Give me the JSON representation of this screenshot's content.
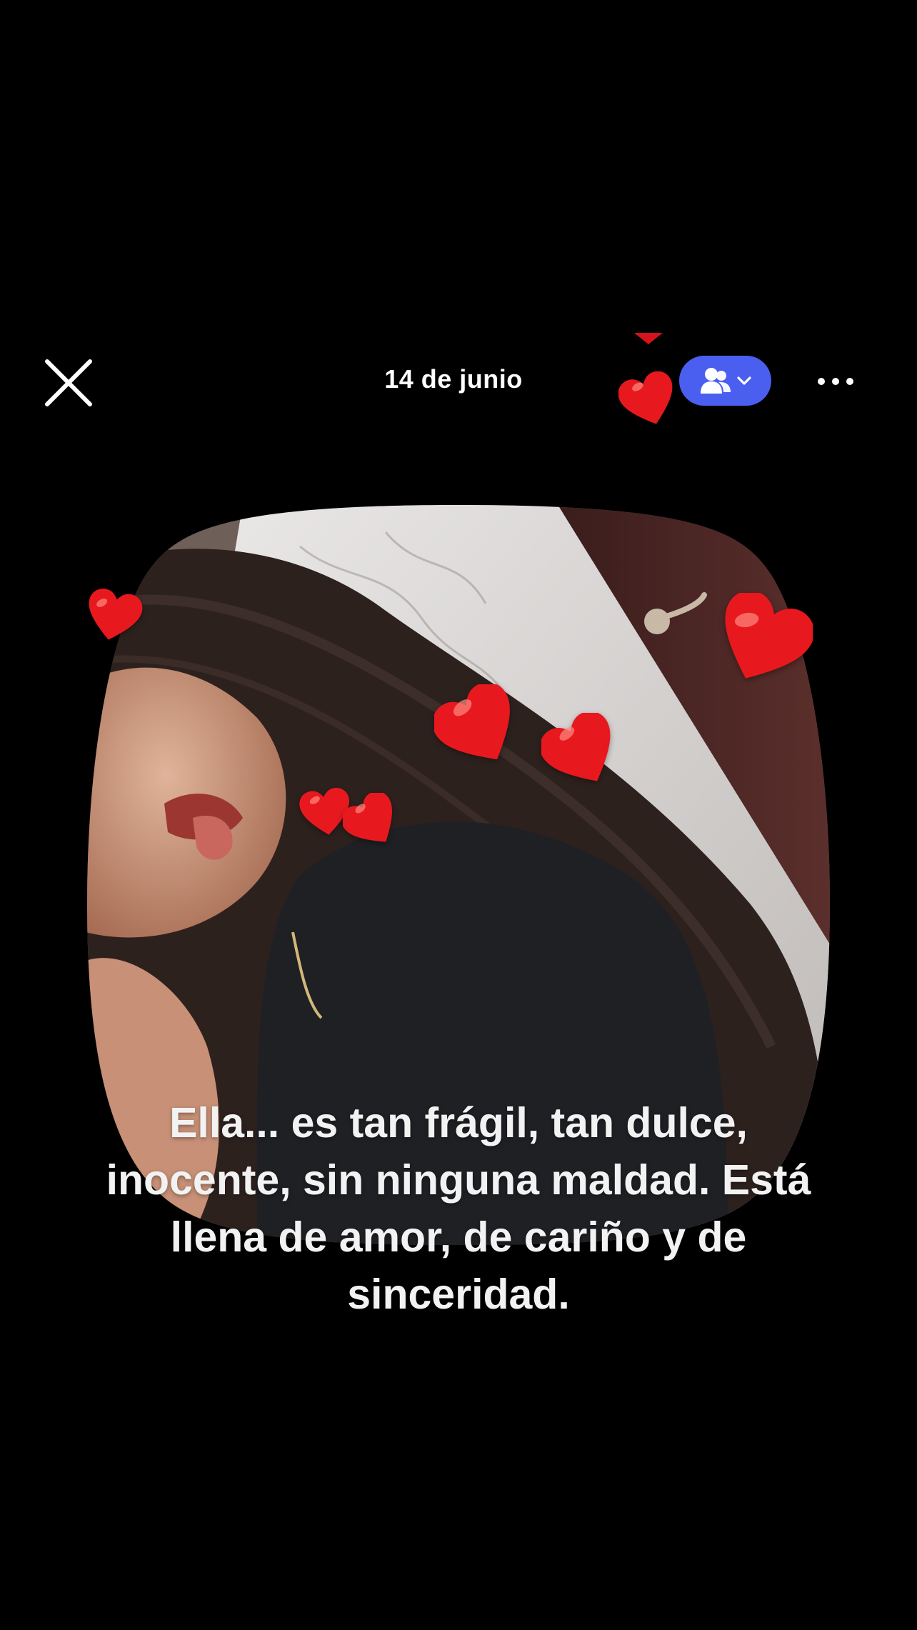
{
  "header": {
    "date": "14 de junio",
    "close_icon": "close-icon",
    "audience_icon": "people-icon",
    "audience_chevron_icon": "chevron-down-icon",
    "more_icon": "more-horizontal-icon"
  },
  "story": {
    "caption": "Ella... es tan frágil, tan dulce, inocente, sin ninguna maldad. Está llena de amor, de cariño y de sinceridad.",
    "sticker_icon": "heart-icon"
  },
  "colors": {
    "background": "#000000",
    "audience_button": "#4a5ff0",
    "heart": "#e8191e",
    "text": "#ffffff"
  }
}
